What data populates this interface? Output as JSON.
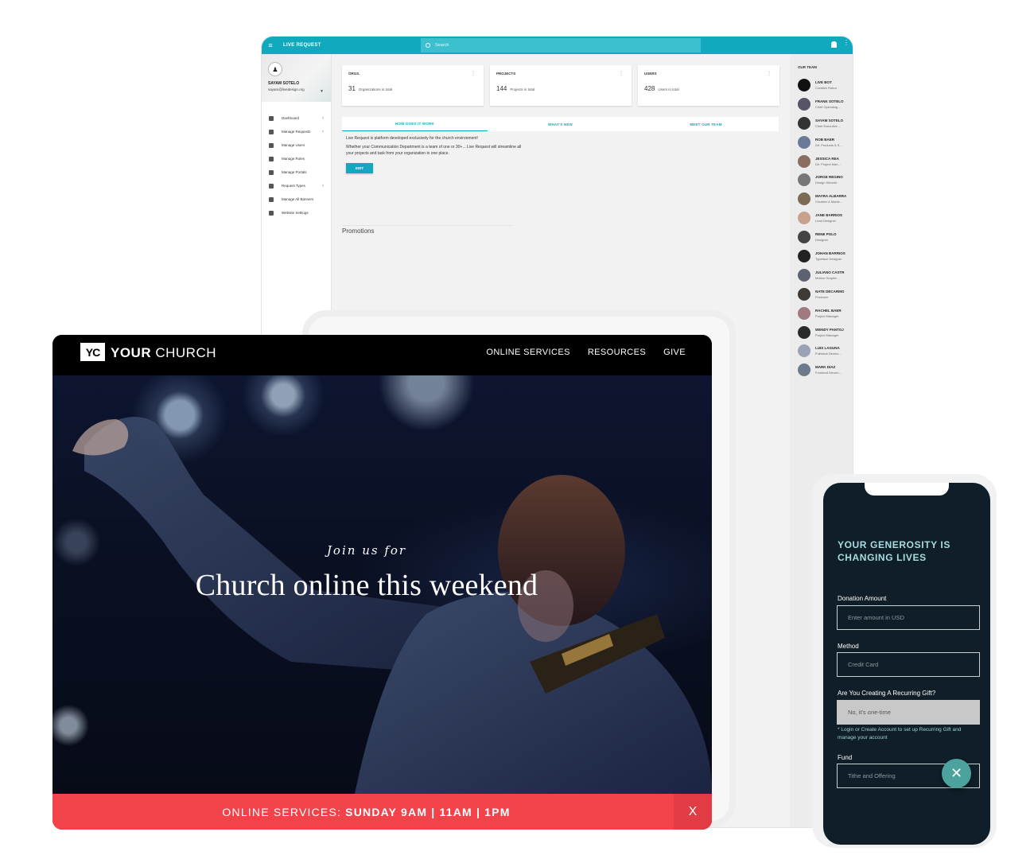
{
  "dashboard": {
    "brand": "LIVE REQUEST",
    "search_placeholder": "Search",
    "profile": {
      "name": "SAYAM SOTELO",
      "email": "sayam@livedesign.org"
    },
    "nav": [
      {
        "label": "Dashboard",
        "icon": "grid-icon",
        "chevron": true
      },
      {
        "label": "Manage Requests",
        "icon": "list-icon",
        "chevron": true
      },
      {
        "label": "Manage Users",
        "icon": "user-icon",
        "chevron": false
      },
      {
        "label": "Manage Roles",
        "icon": "lock-icon",
        "chevron": false
      },
      {
        "label": "Manage Portals",
        "icon": "menu-icon",
        "chevron": false
      },
      {
        "label": "Request Types",
        "icon": "apps-icon",
        "chevron": true
      },
      {
        "label": "Manage All Banners",
        "icon": "image-icon",
        "chevron": false
      },
      {
        "label": "Website Settings",
        "icon": "gear-icon",
        "chevron": false
      }
    ],
    "cards": [
      {
        "title": "ORGS.",
        "value": "31",
        "caption": "Organizations in total"
      },
      {
        "title": "PROJECTS",
        "value": "144",
        "caption": "Projects in total"
      },
      {
        "title": "USERS",
        "value": "428",
        "caption": "Users in total"
      }
    ],
    "tabs": [
      "HOW DOES IT WORK",
      "WHAT'S NEW",
      "MEET OUR TEAM"
    ],
    "tab_body": {
      "p1": "Live Request is platform developed exclusively for the church environment!",
      "p2": "Whether your Communication Department is a team of one or 30+... Live Request will streamline all your projects and task from your organization in one place.",
      "edit": "EDIT"
    },
    "promotions": "Promotions",
    "team_title": "OUR TEAM",
    "team": [
      {
        "name": "LIVE BOT",
        "role": "Creative Robot"
      },
      {
        "name": "FRANK SOTELO",
        "role": "Chief Operating ..."
      },
      {
        "name": "SAYAM SOTELO",
        "role": "Chief Executive ..."
      },
      {
        "name": "ROB BAER",
        "role": "Dir. Products & S..."
      },
      {
        "name": "JESSICA REA",
        "role": "Dir. Project Man..."
      },
      {
        "name": "JORGE REGINO",
        "role": "Design Director"
      },
      {
        "name": "MAYRA ALBARRA",
        "role": "Creative & Marke..."
      },
      {
        "name": "JANE BARRIOS",
        "role": "Lead Designer"
      },
      {
        "name": "RENE POLO",
        "role": "Designer"
      },
      {
        "name": "JOHAN BARRIOS",
        "role": "Typeface Designer"
      },
      {
        "name": "JULIANO CASTR",
        "role": "Motion Graphic ..."
      },
      {
        "name": "NATE DECARMO",
        "role": "Producer"
      },
      {
        "name": "RACHEL BAER",
        "role": "Project Manager"
      },
      {
        "name": "WENDY PANTOJ",
        "role": "Project Manager"
      },
      {
        "name": "LUIS LAGUNA",
        "role": "Fullstack Develo..."
      },
      {
        "name": "MARK DIAZ",
        "role": "Frontend Develo..."
      }
    ]
  },
  "church": {
    "logo": "YC",
    "name_bold": "YOUR",
    "name_rest": " CHURCH",
    "links": [
      "ONLINE SERVICES",
      "RESOURCES",
      "GIVE"
    ],
    "hero_sub": "Join us for",
    "hero_title": "Church online this weekend",
    "banner_lead": "ONLINE SERVICES: ",
    "banner_times": "SUNDAY 9AM | 11AM | 1PM",
    "banner_close": "X"
  },
  "phone": {
    "title": "YOUR GENEROSITY IS CHANGING LIVES",
    "amount_label": "Donation Amount",
    "amount_placeholder": "Enter amount in USD",
    "method_label": "Method",
    "method_value": "Credit Card",
    "recurring_label": "Are You Creating A Recurring Gift?",
    "recurring_value": "No, it's one-time",
    "note": "* Login or Create Account to set up Recurring Gift and manage your account",
    "fund_label": "Fund",
    "fund_value": "Tithe and Offering",
    "fab": "✕"
  },
  "colors": {
    "teal": "#11a9bd",
    "banner_red": "#f2434b",
    "phone_bg": "#0f1e28",
    "fab": "#4ca39d"
  }
}
